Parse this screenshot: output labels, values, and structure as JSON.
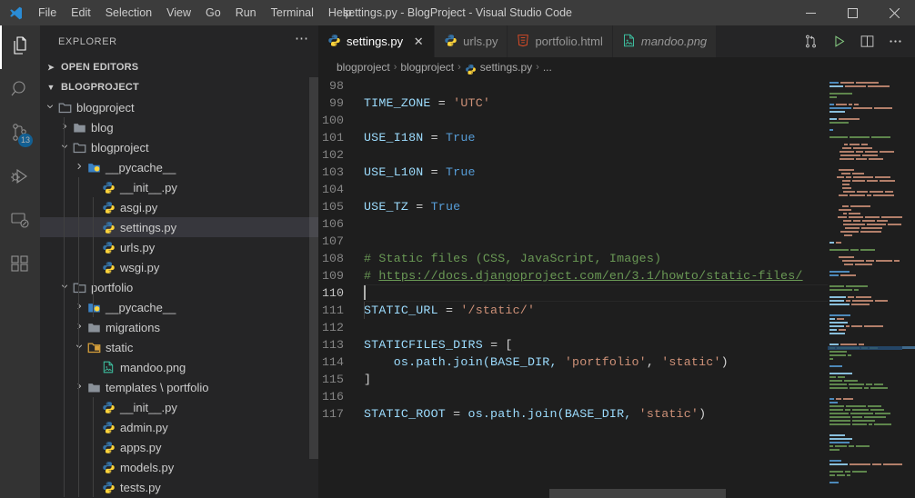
{
  "titlebar": {
    "logo_icon": "vscode-logo-icon",
    "menus": [
      "File",
      "Edit",
      "Selection",
      "View",
      "Go",
      "Run",
      "Terminal",
      "Help"
    ],
    "window_title": "settings.py - BlogProject - Visual Studio Code",
    "controls": [
      {
        "name": "minimize-button",
        "glyph": "minimize-icon"
      },
      {
        "name": "maximize-button",
        "glyph": "maximize-icon"
      },
      {
        "name": "close-button",
        "glyph": "close-icon"
      }
    ]
  },
  "activitybar": {
    "items": [
      {
        "name": "explorer",
        "icon": "files-icon",
        "active": true,
        "badge": null
      },
      {
        "name": "search",
        "icon": "search-icon",
        "active": false,
        "badge": null
      },
      {
        "name": "source-control",
        "icon": "source-control-icon",
        "active": false,
        "badge": "13"
      },
      {
        "name": "run-and-debug",
        "icon": "run-debug-icon",
        "active": false,
        "badge": null
      },
      {
        "name": "remote-explorer",
        "icon": "remote-explorer-icon",
        "active": false,
        "badge": null
      },
      {
        "name": "extensions",
        "icon": "extensions-icon",
        "active": false,
        "badge": null
      }
    ]
  },
  "sidebar": {
    "title": "EXPLORER",
    "more_actions_icon": "ellipsis-icon",
    "sections": [
      {
        "name": "open-editors",
        "label": "OPEN EDITORS",
        "expanded": false
      },
      {
        "name": "blogproject",
        "label": "BLOGPROJECT",
        "expanded": true
      }
    ],
    "tree": [
      {
        "label": "blogproject",
        "type": "folder",
        "icon": "folder-open-icon",
        "depth": 1,
        "expanded": true,
        "selected": false
      },
      {
        "label": "blog",
        "type": "folder",
        "icon": "folder-icon",
        "depth": 2,
        "expanded": false,
        "selected": false
      },
      {
        "label": "blogproject",
        "type": "folder",
        "icon": "folder-open-icon",
        "depth": 2,
        "expanded": true,
        "selected": false
      },
      {
        "label": "__pycache__",
        "type": "folder",
        "icon": "folder-python-icon",
        "depth": 3,
        "expanded": false,
        "selected": false
      },
      {
        "label": "__init__.py",
        "type": "file",
        "icon": "python-icon",
        "depth": 4,
        "expanded": null,
        "selected": false
      },
      {
        "label": "asgi.py",
        "type": "file",
        "icon": "python-icon",
        "depth": 4,
        "expanded": null,
        "selected": false
      },
      {
        "label": "settings.py",
        "type": "file",
        "icon": "python-icon",
        "depth": 4,
        "expanded": null,
        "selected": true
      },
      {
        "label": "urls.py",
        "type": "file",
        "icon": "python-icon",
        "depth": 4,
        "expanded": null,
        "selected": false
      },
      {
        "label": "wsgi.py",
        "type": "file",
        "icon": "python-icon",
        "depth": 4,
        "expanded": null,
        "selected": false
      },
      {
        "label": "portfolio",
        "type": "folder",
        "icon": "folder-open-icon",
        "depth": 2,
        "expanded": true,
        "selected": false
      },
      {
        "label": "__pycache__",
        "type": "folder",
        "icon": "folder-python-icon",
        "depth": 3,
        "expanded": false,
        "selected": false
      },
      {
        "label": "migrations",
        "type": "folder",
        "icon": "folder-icon",
        "depth": 3,
        "expanded": false,
        "selected": false
      },
      {
        "label": "static",
        "type": "folder",
        "icon": "folder-static-icon",
        "depth": 3,
        "expanded": true,
        "selected": false
      },
      {
        "label": "mandoo.png",
        "type": "file",
        "icon": "image-icon",
        "depth": 4,
        "expanded": null,
        "selected": false
      },
      {
        "label": "templates \\ portfolio",
        "type": "folder",
        "icon": "folder-icon",
        "depth": 3,
        "expanded": false,
        "selected": false
      },
      {
        "label": "__init__.py",
        "type": "file",
        "icon": "python-icon",
        "depth": 4,
        "expanded": null,
        "selected": false
      },
      {
        "label": "admin.py",
        "type": "file",
        "icon": "python-icon",
        "depth": 4,
        "expanded": null,
        "selected": false
      },
      {
        "label": "apps.py",
        "type": "file",
        "icon": "python-icon",
        "depth": 4,
        "expanded": null,
        "selected": false
      },
      {
        "label": "models.py",
        "type": "file",
        "icon": "python-icon",
        "depth": 4,
        "expanded": null,
        "selected": false
      },
      {
        "label": "tests.py",
        "type": "file",
        "icon": "python-icon",
        "depth": 4,
        "expanded": null,
        "selected": false
      }
    ]
  },
  "tabs": {
    "items": [
      {
        "label": "settings.py",
        "icon": "python-icon",
        "active": true,
        "italic": false,
        "closable": true
      },
      {
        "label": "urls.py",
        "icon": "python-icon",
        "active": false,
        "italic": false,
        "closable": false
      },
      {
        "label": "portfolio.html",
        "icon": "html-icon",
        "active": false,
        "italic": false,
        "closable": false
      },
      {
        "label": "mandoo.png",
        "icon": "image-icon",
        "active": false,
        "italic": true,
        "closable": false
      }
    ],
    "actions": [
      {
        "name": "split-source-control-icon",
        "glyph": "compare-changes-icon"
      },
      {
        "name": "run-python-file-button",
        "glyph": "play-icon"
      },
      {
        "name": "split-editor-button",
        "glyph": "split-editor-icon"
      },
      {
        "name": "more-actions-button",
        "glyph": "ellipsis-icon"
      }
    ]
  },
  "breadcrumb": {
    "items": [
      "blogproject",
      "blogproject",
      "settings.py",
      "..."
    ],
    "file_icon": "python-icon",
    "separator": "›"
  },
  "editor": {
    "first_visible_line": 98,
    "cursor_line": 110,
    "lines": [
      {
        "n": 98,
        "tokens": []
      },
      {
        "n": 99,
        "tokens": [
          {
            "t": "TIME_ZONE ",
            "c": "var"
          },
          {
            "t": "= ",
            "c": "op"
          },
          {
            "t": "'UTC'",
            "c": "str"
          }
        ]
      },
      {
        "n": 100,
        "tokens": []
      },
      {
        "n": 101,
        "tokens": [
          {
            "t": "USE_I18N ",
            "c": "var"
          },
          {
            "t": "= ",
            "c": "op"
          },
          {
            "t": "True",
            "c": "const"
          }
        ]
      },
      {
        "n": 102,
        "tokens": []
      },
      {
        "n": 103,
        "tokens": [
          {
            "t": "USE_L10N ",
            "c": "var"
          },
          {
            "t": "= ",
            "c": "op"
          },
          {
            "t": "True",
            "c": "const"
          }
        ]
      },
      {
        "n": 104,
        "tokens": []
      },
      {
        "n": 105,
        "tokens": [
          {
            "t": "USE_TZ ",
            "c": "var"
          },
          {
            "t": "= ",
            "c": "op"
          },
          {
            "t": "True",
            "c": "const"
          }
        ]
      },
      {
        "n": 106,
        "tokens": []
      },
      {
        "n": 107,
        "tokens": []
      },
      {
        "n": 108,
        "tokens": [
          {
            "t": "# Static files (CSS, JavaScript, Images)",
            "c": "comment"
          }
        ]
      },
      {
        "n": 109,
        "tokens": [
          {
            "t": "# ",
            "c": "comment"
          },
          {
            "t": "https://docs.djangoproject.com/en/3.1/howto/static-files/",
            "c": "link"
          }
        ]
      },
      {
        "n": 110,
        "tokens": []
      },
      {
        "n": 111,
        "tokens": [
          {
            "t": "STATIC_URL ",
            "c": "var"
          },
          {
            "t": "= ",
            "c": "op"
          },
          {
            "t": "'/static/'",
            "c": "str"
          }
        ]
      },
      {
        "n": 112,
        "tokens": []
      },
      {
        "n": 113,
        "tokens": [
          {
            "t": "STATICFILES_DIRS ",
            "c": "var"
          },
          {
            "t": "= ",
            "c": "op"
          },
          {
            "t": "[",
            "c": "punc"
          }
        ]
      },
      {
        "n": 114,
        "tokens": [
          {
            "t": "    os.path.join(BASE_DIR, ",
            "c": "var"
          },
          {
            "t": "'portfolio'",
            "c": "str"
          },
          {
            "t": ", ",
            "c": "punc"
          },
          {
            "t": "'static'",
            "c": "str"
          },
          {
            "t": ")",
            "c": "punc"
          }
        ]
      },
      {
        "n": 115,
        "tokens": [
          {
            "t": "]",
            "c": "punc"
          }
        ]
      },
      {
        "n": 116,
        "tokens": []
      },
      {
        "n": 117,
        "tokens": [
          {
            "t": "STATIC_ROOT ",
            "c": "var"
          },
          {
            "t": "= ",
            "c": "op"
          },
          {
            "t": "os.path.join(BASE_DIR, ",
            "c": "var"
          },
          {
            "t": "'static'",
            "c": "str"
          },
          {
            "t": ")",
            "c": "punc"
          }
        ]
      }
    ]
  },
  "colors": {
    "accent": "#007acc",
    "titlebar_bg": "#3c3c3c",
    "sidebar_bg": "#252526",
    "editor_bg": "#1e1e1e",
    "activitybar_bg": "#333333",
    "selection_bg": "#37373d",
    "comment": "#6a9955",
    "string": "#ce9178",
    "constant": "#569cd6",
    "variable": "#9cdcfe"
  }
}
